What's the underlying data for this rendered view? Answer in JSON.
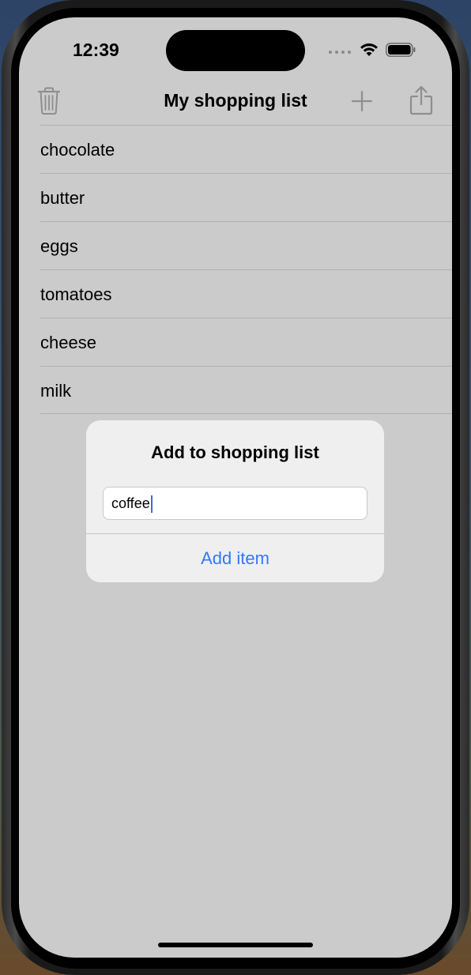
{
  "status_bar": {
    "time": "12:39"
  },
  "nav": {
    "title": "My shopping list",
    "left_icon": "trash-icon",
    "right_icons": [
      "plus-icon",
      "share-icon"
    ]
  },
  "list": {
    "items": [
      {
        "label": "chocolate"
      },
      {
        "label": "butter"
      },
      {
        "label": "eggs"
      },
      {
        "label": "tomatoes"
      },
      {
        "label": "cheese"
      },
      {
        "label": "milk"
      }
    ]
  },
  "alert": {
    "title": "Add to shopping list",
    "input_value": "coffee",
    "action_label": "Add item"
  },
  "colors": {
    "accent": "#3478f6",
    "screen_background": "#cbcbcb",
    "alert_background": "#efefef"
  }
}
